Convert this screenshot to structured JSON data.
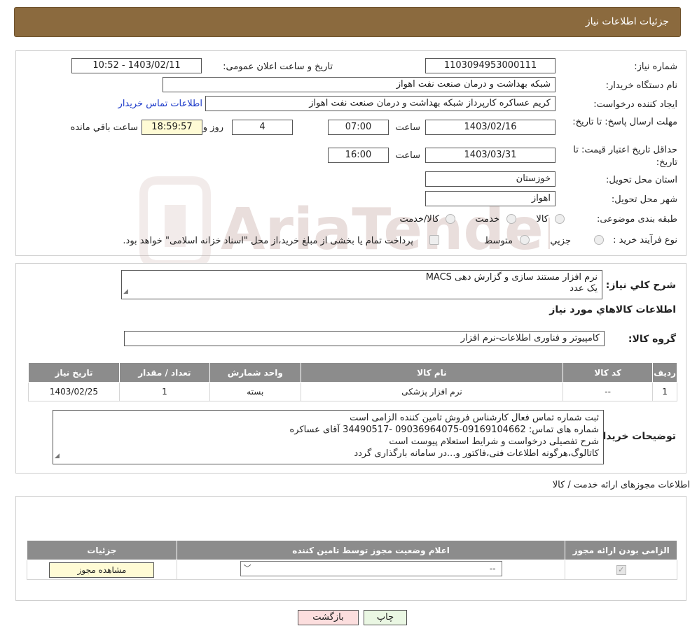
{
  "header": {
    "title": "جزئیات اطلاعات نیاز"
  },
  "main": {
    "need_number_label": "شماره نیاز:",
    "need_number": "1103094953000111",
    "announce_datetime_label": "تاریخ و ساعت اعلان عمومی:",
    "announce_datetime": "1403/02/11 - 10:52",
    "buyer_org_label": "نام دستگاه خریدار:",
    "buyer_org": "شبکه بهداشت و درمان صنعت نفت اهواز",
    "requester_label": "ایجاد کننده درخواست:",
    "requester": "کریم عساکره کارپرداز شبکه بهداشت و درمان صنعت نفت اهواز",
    "buyer_contact_link": "اطلاعات تماس خریدار",
    "deadline_label": "مهلت ارسال پاسخ: تا تاریخ:",
    "deadline_date": "1403/02/16",
    "time_word": "ساعت",
    "deadline_time": "07:00",
    "remaining_days": "4",
    "day_and": "روز و",
    "remaining_time": "18:59:57",
    "remaining_suffix": "ساعت باقي مانده",
    "price_validity_label": "حداقل تاریخ اعتبار قیمت: تا تاریخ:",
    "price_validity_date": "1403/03/31",
    "price_validity_time": "16:00",
    "province_label": "استان محل تحویل:",
    "province": "خوزستان",
    "city_label": "شهر محل تحویل:",
    "city": "اهواز",
    "category_label": "طبقه بندی موضوعی:",
    "category_options": [
      "کالا",
      "خدمت",
      "کالا/خدمت"
    ],
    "purchase_type_label": "نوع فرآیند خرید :",
    "purchase_options": [
      "جزیي",
      "متوسط"
    ],
    "purchase_note": "پرداخت تمام یا بخشی از مبلغ خرید،از محل \"اسناد خزانه اسلامی\" خواهد بود."
  },
  "summary": {
    "label": "شرح کلي نياز:",
    "line1": "نرم افزار مستند سازی و گزارش دهی MACS",
    "line2": "یک عدد"
  },
  "goods": {
    "section_title": "اطلاعات کالاهاي مورد نياز",
    "group_label": "گروه کالا:",
    "group_value": "کامپیوتر و فناوری اطلاعات-نرم افزار",
    "columns": [
      "رديف",
      "کد کالا",
      "نام کالا",
      "واحد شمارش",
      "تعداد / مقدار",
      "تاریخ نیاز"
    ],
    "rows": [
      [
        "1",
        "--",
        "نرم افزار پزشکی",
        "بسته",
        "1",
        "1403/02/25"
      ]
    ]
  },
  "buyer_notes": {
    "label": "توضیحات خریدار:",
    "lines": [
      "ثبت شماره تماس فعال کارشناس فروش تامین کننده الزامی است",
      "شماره های تماس: 09169104662-09036964075 -34490517 آقای عساکره",
      "شرح تفصیلی درخواست و شرایط استعلام پیوست است",
      "کاتالوگ،هرگونه اطلاعات فنی،فاکتور و...در سامانه بارگذاری گردد"
    ]
  },
  "permits": {
    "section_title": "اطلاعات مجوزهای ارائه خدمت / کالا",
    "columns": [
      "الزامی بودن ارائه مجوز",
      "اعلام وضعیت مجوز توسط تامین کننده",
      "جزئیات"
    ],
    "select_value": "--",
    "view_button": "مشاهده مجوز"
  },
  "actions": {
    "print": "چاپ",
    "back": "بازگشت"
  },
  "watermark": {
    "text": "AriaTender.neT"
  }
}
